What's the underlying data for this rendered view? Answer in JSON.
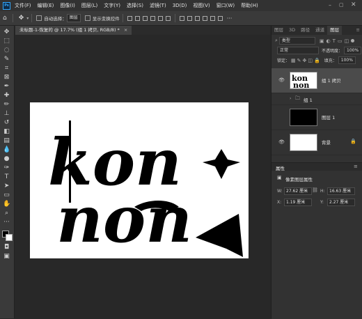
{
  "app": {
    "logo_text": "Ps"
  },
  "menus": [
    "文件(F)",
    "编辑(E)",
    "图像(I)",
    "图层(L)",
    "文字(Y)",
    "选择(S)",
    "滤镜(T)",
    "3D(D)",
    "视图(V)",
    "窗口(W)",
    "帮助(H)"
  ],
  "options": {
    "auto_select_label": "自动选择：",
    "target_select": "图层",
    "transform_controls_label": "显示变换控件"
  },
  "document": {
    "tab_title": "未标题-1-恢复的 @ 17.7% (组 1 拷贝, RGB/8) *",
    "close_glyph": "×"
  },
  "artwork": {
    "lines": [
      "kon",
      "non"
    ]
  },
  "panel_tabs": [
    "图层",
    "3D",
    "路径",
    "通道",
    "图层"
  ],
  "layers_panel": {
    "filter_kind": "类型",
    "blend_mode": "正常",
    "opacity_label": "不透明度：",
    "opacity_value": "100%",
    "lock_label": "锁定：",
    "fill_label": "填充：",
    "fill_value": "100%",
    "layers": [
      {
        "name": "组 1 拷贝",
        "visible": true,
        "selected": true,
        "thumb": "artwork"
      },
      {
        "name": "组 1",
        "visible": false,
        "selected": false,
        "thumb": "folder"
      },
      {
        "name": "图层 1",
        "visible": false,
        "selected": false,
        "thumb": "black"
      },
      {
        "name": "背景",
        "visible": true,
        "selected": false,
        "thumb": "white"
      }
    ]
  },
  "properties": {
    "tab": "属性",
    "section": "像素图层属性",
    "w_label": "W:",
    "w_value": "27.62 厘米",
    "h_label": "H:",
    "h_value": "16.63 厘米",
    "x_label": "X:",
    "x_value": "1.19 厘米",
    "y_label": "Y:",
    "y_value": "2.27 厘米"
  }
}
